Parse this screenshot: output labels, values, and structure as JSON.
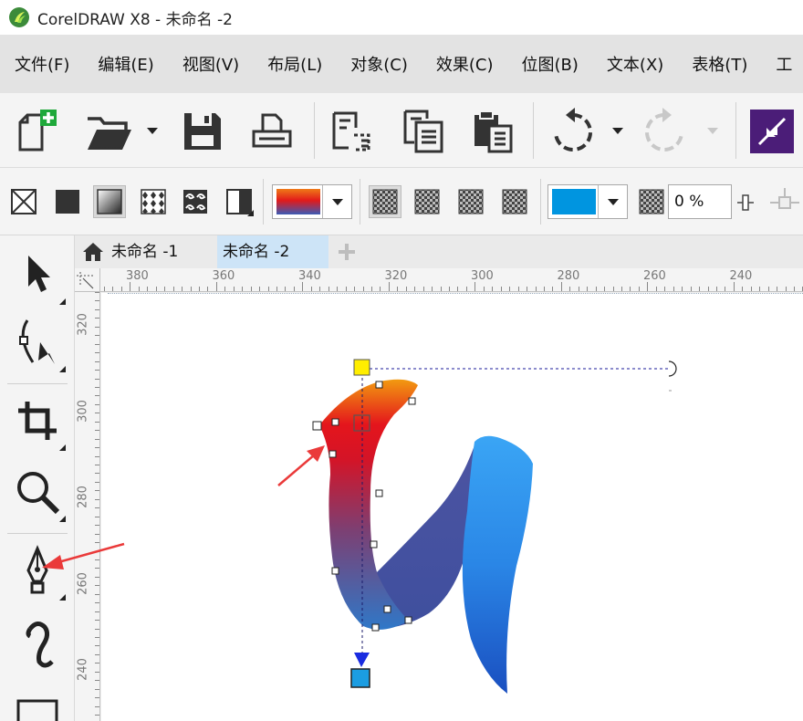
{
  "window": {
    "title": "CorelDRAW X8 - 未命名 -2"
  },
  "menu": {
    "items": [
      "文件(F)",
      "编辑(E)",
      "视图(V)",
      "布局(L)",
      "对象(C)",
      "效果(C)",
      "位图(B)",
      "文本(X)",
      "表格(T)",
      "工"
    ]
  },
  "toolbar": {
    "icons": [
      "new-document-icon",
      "open-folder-icon",
      "save-icon",
      "print-icon",
      "import-icon",
      "export-icon",
      "clipboard-icon",
      "undo-icon",
      "redo-icon",
      "launcher-icon"
    ]
  },
  "property_bar": {
    "transparency_value": "0 %",
    "fill_gradient_colors": [
      "#e21a1a",
      "#ef7a18",
      "#3a5ab5"
    ],
    "solid_color": "#0095e0"
  },
  "tabs": {
    "items": [
      "未命名 -1",
      "未命名 -2"
    ],
    "active_index": 1
  },
  "rulers": {
    "top": [
      "380",
      "360",
      "340",
      "320",
      "300",
      "280",
      "260",
      "240"
    ],
    "left": [
      "320",
      "300",
      "280",
      "260",
      "240"
    ]
  },
  "colors": {
    "accent_blue": "#2b8af0",
    "arrow_red": "#ea3a3a",
    "handle_yellow": "#ffee00",
    "handle_blue": "#1b9de2"
  }
}
